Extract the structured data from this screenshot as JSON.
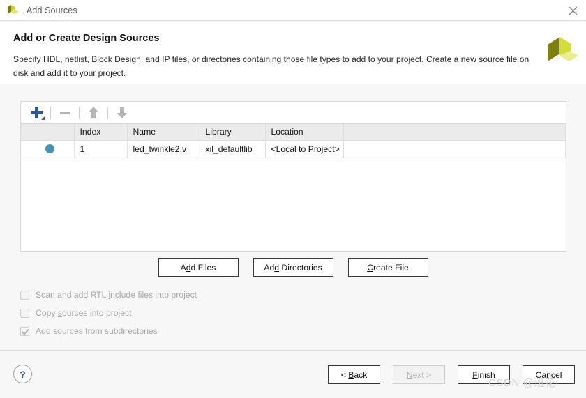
{
  "window": {
    "title": "Add Sources",
    "app_icon": "xilinx-logo-icon",
    "close_icon": "close-icon"
  },
  "header": {
    "title": "Add or Create Design Sources",
    "description": "Specify HDL, netlist, Block Design, and IP files, or directories containing those file types to add to your project. Create a new source file on disk and add it to your project.",
    "brand_icon": "xilinx-logo-icon"
  },
  "toolbar": {
    "add_label": "+",
    "add_icon": "plus-icon",
    "remove_icon": "minus-icon",
    "move_up_icon": "arrow-up-icon",
    "move_down_icon": "arrow-down-icon"
  },
  "table": {
    "columns": [
      "",
      "Index",
      "Name",
      "Library",
      "Location",
      ""
    ],
    "rows": [
      {
        "status": "source-ok",
        "index": "1",
        "name": "led_twinkle2.v",
        "library": "xil_defaultlib",
        "location": "<Local to Project>"
      }
    ]
  },
  "actions": {
    "add_files": {
      "pre": "A",
      "mnemonic": "d",
      "post": "d Files"
    },
    "add_directories": {
      "pre": "Ad",
      "mnemonic": "d",
      "post": " Directories"
    },
    "create_file": {
      "pre": "",
      "mnemonic": "C",
      "post": "reate File"
    }
  },
  "options": [
    {
      "id": "scan-rtl-include",
      "pre": "Scan and add RTL ",
      "mnemonic": "i",
      "post": "nclude files into project",
      "checked": false,
      "enabled": false
    },
    {
      "id": "copy-sources",
      "pre": "Copy ",
      "mnemonic": "s",
      "post": "ources into project",
      "checked": false,
      "enabled": false
    },
    {
      "id": "add-subdirectories",
      "pre": "Add so",
      "mnemonic": "u",
      "post": "rces from subdirectories",
      "checked": true,
      "enabled": false
    }
  ],
  "footer": {
    "help_label": "?",
    "back": {
      "pre": "< ",
      "mnemonic": "B",
      "post": "ack",
      "enabled": true
    },
    "next": {
      "pre": "",
      "mnemonic": "N",
      "post": "ext >",
      "enabled": false
    },
    "finish": {
      "pre": "",
      "mnemonic": "F",
      "post": "inish",
      "enabled": true
    },
    "cancel": {
      "pre": "Cancel",
      "mnemonic": "",
      "post": "",
      "enabled": true
    }
  },
  "watermark": "CSDN @班花i"
}
